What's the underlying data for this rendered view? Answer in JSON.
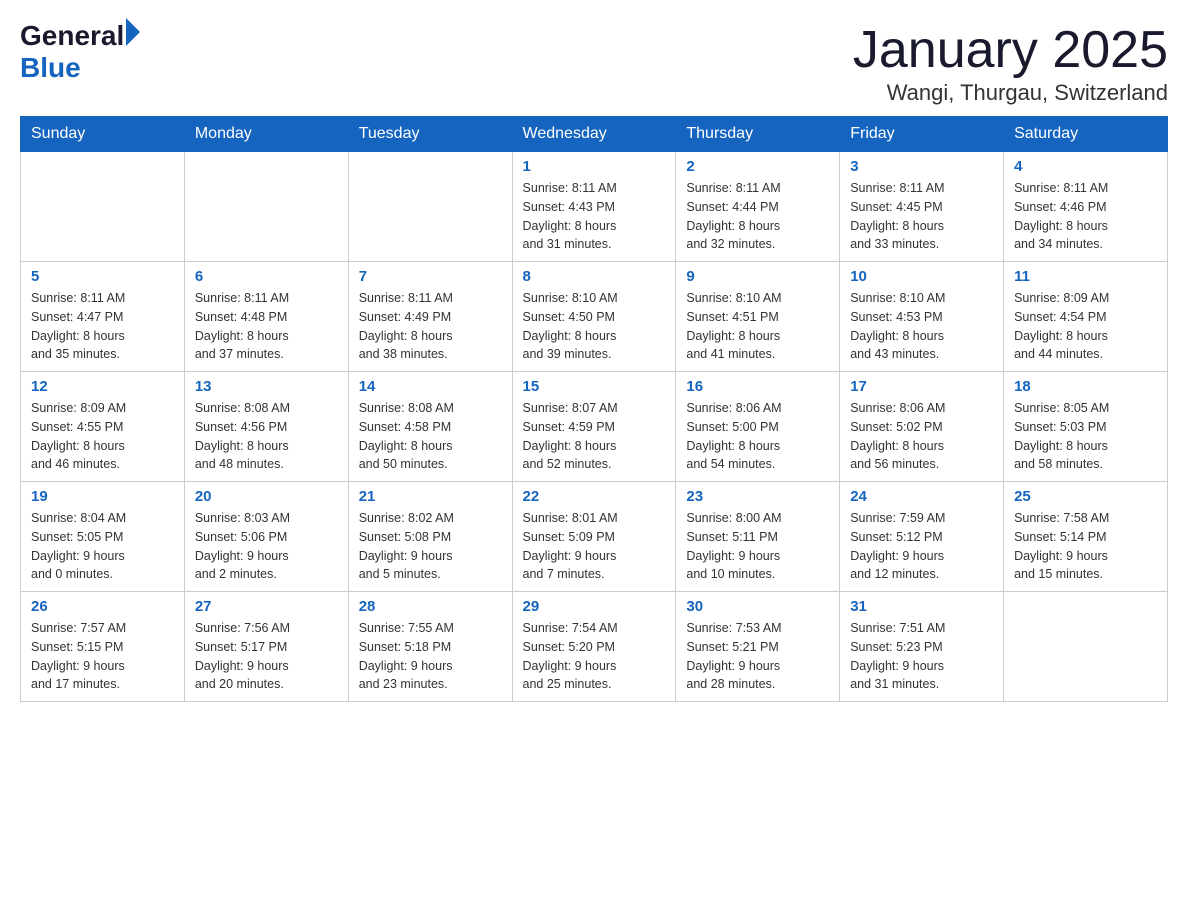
{
  "header": {
    "logo": {
      "text_general": "General",
      "text_blue": "Blue",
      "arrow": true
    },
    "title": "January 2025",
    "subtitle": "Wangi, Thurgau, Switzerland"
  },
  "days_of_week": [
    "Sunday",
    "Monday",
    "Tuesday",
    "Wednesday",
    "Thursday",
    "Friday",
    "Saturday"
  ],
  "weeks": [
    {
      "days": [
        {
          "number": "",
          "info": ""
        },
        {
          "number": "",
          "info": ""
        },
        {
          "number": "",
          "info": ""
        },
        {
          "number": "1",
          "info": "Sunrise: 8:11 AM\nSunset: 4:43 PM\nDaylight: 8 hours\nand 31 minutes."
        },
        {
          "number": "2",
          "info": "Sunrise: 8:11 AM\nSunset: 4:44 PM\nDaylight: 8 hours\nand 32 minutes."
        },
        {
          "number": "3",
          "info": "Sunrise: 8:11 AM\nSunset: 4:45 PM\nDaylight: 8 hours\nand 33 minutes."
        },
        {
          "number": "4",
          "info": "Sunrise: 8:11 AM\nSunset: 4:46 PM\nDaylight: 8 hours\nand 34 minutes."
        }
      ]
    },
    {
      "days": [
        {
          "number": "5",
          "info": "Sunrise: 8:11 AM\nSunset: 4:47 PM\nDaylight: 8 hours\nand 35 minutes."
        },
        {
          "number": "6",
          "info": "Sunrise: 8:11 AM\nSunset: 4:48 PM\nDaylight: 8 hours\nand 37 minutes."
        },
        {
          "number": "7",
          "info": "Sunrise: 8:11 AM\nSunset: 4:49 PM\nDaylight: 8 hours\nand 38 minutes."
        },
        {
          "number": "8",
          "info": "Sunrise: 8:10 AM\nSunset: 4:50 PM\nDaylight: 8 hours\nand 39 minutes."
        },
        {
          "number": "9",
          "info": "Sunrise: 8:10 AM\nSunset: 4:51 PM\nDaylight: 8 hours\nand 41 minutes."
        },
        {
          "number": "10",
          "info": "Sunrise: 8:10 AM\nSunset: 4:53 PM\nDaylight: 8 hours\nand 43 minutes."
        },
        {
          "number": "11",
          "info": "Sunrise: 8:09 AM\nSunset: 4:54 PM\nDaylight: 8 hours\nand 44 minutes."
        }
      ]
    },
    {
      "days": [
        {
          "number": "12",
          "info": "Sunrise: 8:09 AM\nSunset: 4:55 PM\nDaylight: 8 hours\nand 46 minutes."
        },
        {
          "number": "13",
          "info": "Sunrise: 8:08 AM\nSunset: 4:56 PM\nDaylight: 8 hours\nand 48 minutes."
        },
        {
          "number": "14",
          "info": "Sunrise: 8:08 AM\nSunset: 4:58 PM\nDaylight: 8 hours\nand 50 minutes."
        },
        {
          "number": "15",
          "info": "Sunrise: 8:07 AM\nSunset: 4:59 PM\nDaylight: 8 hours\nand 52 minutes."
        },
        {
          "number": "16",
          "info": "Sunrise: 8:06 AM\nSunset: 5:00 PM\nDaylight: 8 hours\nand 54 minutes."
        },
        {
          "number": "17",
          "info": "Sunrise: 8:06 AM\nSunset: 5:02 PM\nDaylight: 8 hours\nand 56 minutes."
        },
        {
          "number": "18",
          "info": "Sunrise: 8:05 AM\nSunset: 5:03 PM\nDaylight: 8 hours\nand 58 minutes."
        }
      ]
    },
    {
      "days": [
        {
          "number": "19",
          "info": "Sunrise: 8:04 AM\nSunset: 5:05 PM\nDaylight: 9 hours\nand 0 minutes."
        },
        {
          "number": "20",
          "info": "Sunrise: 8:03 AM\nSunset: 5:06 PM\nDaylight: 9 hours\nand 2 minutes."
        },
        {
          "number": "21",
          "info": "Sunrise: 8:02 AM\nSunset: 5:08 PM\nDaylight: 9 hours\nand 5 minutes."
        },
        {
          "number": "22",
          "info": "Sunrise: 8:01 AM\nSunset: 5:09 PM\nDaylight: 9 hours\nand 7 minutes."
        },
        {
          "number": "23",
          "info": "Sunrise: 8:00 AM\nSunset: 5:11 PM\nDaylight: 9 hours\nand 10 minutes."
        },
        {
          "number": "24",
          "info": "Sunrise: 7:59 AM\nSunset: 5:12 PM\nDaylight: 9 hours\nand 12 minutes."
        },
        {
          "number": "25",
          "info": "Sunrise: 7:58 AM\nSunset: 5:14 PM\nDaylight: 9 hours\nand 15 minutes."
        }
      ]
    },
    {
      "days": [
        {
          "number": "26",
          "info": "Sunrise: 7:57 AM\nSunset: 5:15 PM\nDaylight: 9 hours\nand 17 minutes."
        },
        {
          "number": "27",
          "info": "Sunrise: 7:56 AM\nSunset: 5:17 PM\nDaylight: 9 hours\nand 20 minutes."
        },
        {
          "number": "28",
          "info": "Sunrise: 7:55 AM\nSunset: 5:18 PM\nDaylight: 9 hours\nand 23 minutes."
        },
        {
          "number": "29",
          "info": "Sunrise: 7:54 AM\nSunset: 5:20 PM\nDaylight: 9 hours\nand 25 minutes."
        },
        {
          "number": "30",
          "info": "Sunrise: 7:53 AM\nSunset: 5:21 PM\nDaylight: 9 hours\nand 28 minutes."
        },
        {
          "number": "31",
          "info": "Sunrise: 7:51 AM\nSunset: 5:23 PM\nDaylight: 9 hours\nand 31 minutes."
        },
        {
          "number": "",
          "info": ""
        }
      ]
    }
  ]
}
